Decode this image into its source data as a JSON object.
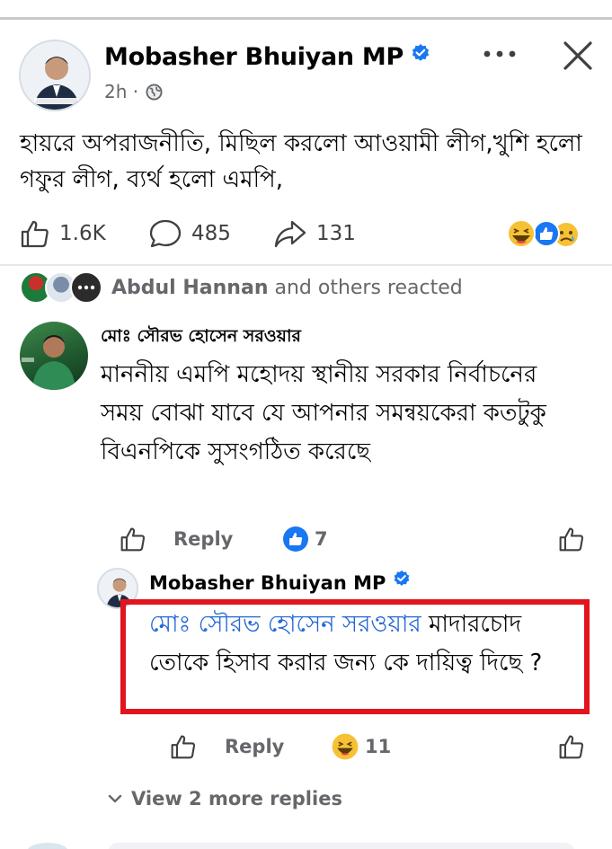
{
  "post": {
    "author": "Mobasher Bhuiyan MP",
    "time": "2h",
    "separator": "·",
    "text": "হায়রে অপরাজনীতি, মিছিল করলো আওয়ামী লীগ,খুশি হলো গফুর লীগ, ব্যর্থ হলো এমপি,",
    "likes": "1.6K",
    "comments": "485",
    "shares": "131"
  },
  "reacted": {
    "name": "Abdul Hannan",
    "suffix": " and others reacted"
  },
  "comment": {
    "author": "মোঃ সৌরভ হোসেন সরওয়ার",
    "text": "মাননীয় এমপি মহোদয় স্থানীয় সরকার নির্বাচনের সময় বোঝা যাবে যে আপনার সমন্বয়কেরা  কতটুকু বিএনপিকে সুসংগঠিত করেছে",
    "reply_label": "Reply",
    "reaction_count": "7"
  },
  "reply": {
    "author": "Mobasher Bhuiyan MP",
    "mention": "মোঃ সৌরভ হোসেন সরওয়ার",
    "text": " মাদারচোদ তোকে হিসাব করার জন্য কে দায়িত্ব দিছে ?",
    "reply_label": "Reply",
    "reaction_count": "11"
  },
  "view_more": "View 2 more replies",
  "colors": {
    "accent": "#1877f2",
    "mention": "#2568d6",
    "highlight": "#e2141d",
    "muted": "#65676b"
  },
  "icons": [
    "verified-badge-icon",
    "globe-icon",
    "more-icon",
    "close-icon",
    "like-icon",
    "comment-icon",
    "share-icon",
    "haha-reaction-icon",
    "like-reaction-icon",
    "sad-reaction-icon",
    "chevron-down-icon"
  ]
}
